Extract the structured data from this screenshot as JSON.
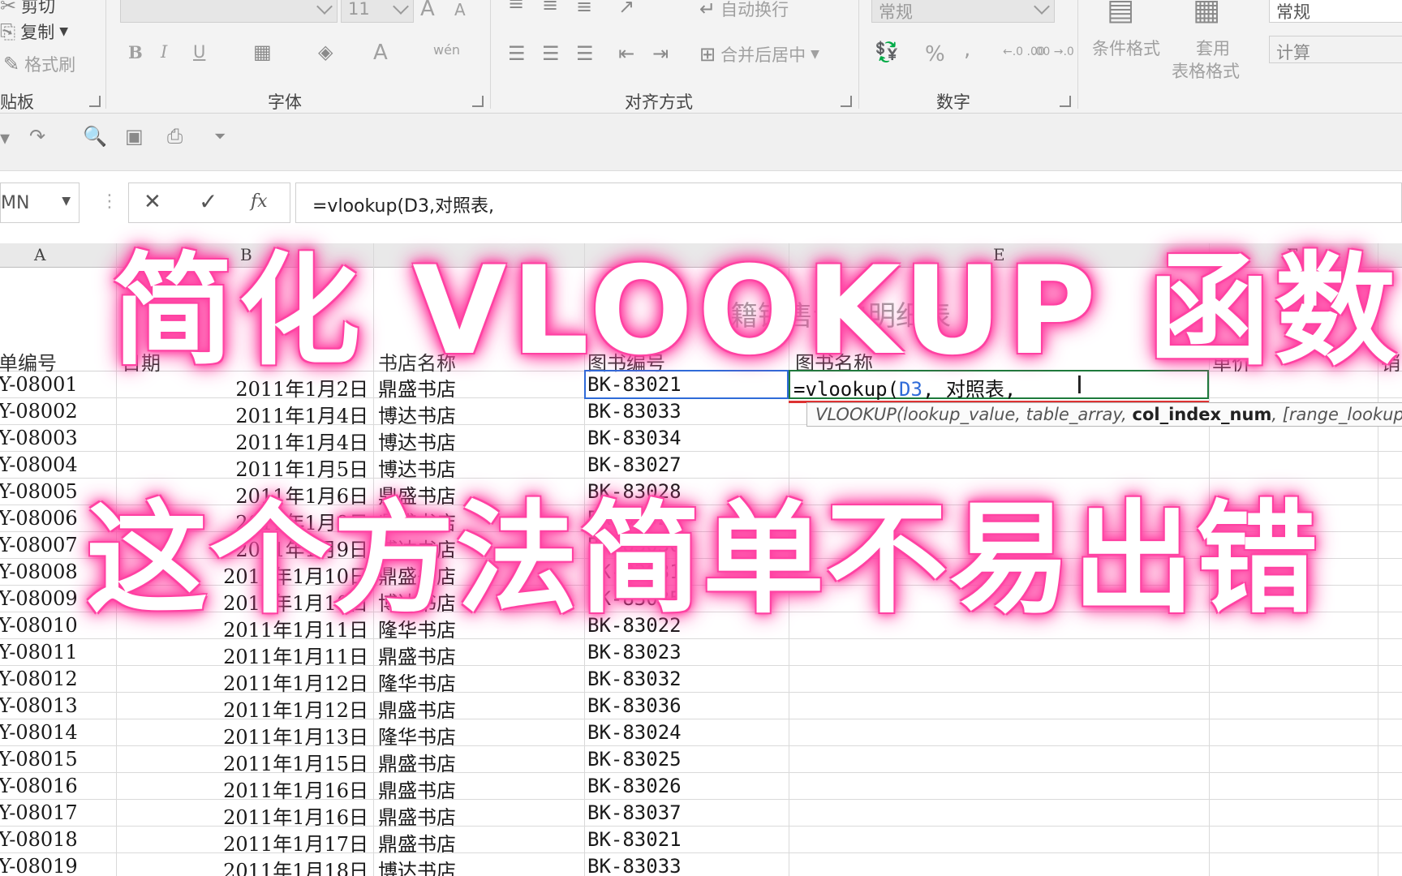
{
  "ribbon": {
    "clipboard": {
      "cut": "剪切",
      "copy": "复制",
      "format_painter": "格式刷",
      "label": "贴板"
    },
    "font": {
      "size": "11",
      "bold": "B",
      "italic": "I",
      "underline": "U",
      "font_color": "A",
      "wen": "wén",
      "label": "字体"
    },
    "alignment": {
      "wrap": "自动换行",
      "merge": "合并后居中",
      "label": "对齐方式"
    },
    "number": {
      "format": "常规",
      "percent": "%",
      "comma": ",",
      "inc_decimal": "←.0 .00",
      "dec_decimal": ".00 →.0",
      "label": "数字"
    },
    "styles": {
      "conditional": "条件格式",
      "table_fmt_1": "套用",
      "table_fmt_2": "表格格式",
      "style_normal": "常规",
      "style_calc": "计算"
    }
  },
  "formula_bar": {
    "name_box": "MN",
    "cancel": "✕",
    "enter": "✓",
    "fx": "fx",
    "content": "=vlookup(D3,对照表,"
  },
  "columns": [
    "A",
    "B",
    "E",
    "F"
  ],
  "sheet": {
    "title_faint": "籍销售订单明细表",
    "headers": {
      "order_no": "单编号",
      "date": "日期",
      "store": "书店名称",
      "book_code": "图书编号",
      "book_name": "图书名称",
      "price": "单价",
      "sales": "销"
    },
    "rows": [
      {
        "no": "Y-08001",
        "date": "2011年1月2日",
        "store": "鼎盛书店",
        "code": "BK-83021"
      },
      {
        "no": "Y-08002",
        "date": "2011年1月4日",
        "store": "博达书店",
        "code": "BK-83033"
      },
      {
        "no": "Y-08003",
        "date": "2011年1月4日",
        "store": "博达书店",
        "code": "BK-83034"
      },
      {
        "no": "Y-08004",
        "date": "2011年1月5日",
        "store": "博达书店",
        "code": "BK-83027"
      },
      {
        "no": "Y-08005",
        "date": "2011年1月6日",
        "store": "鼎盛书店",
        "code": "BK-83028"
      },
      {
        "no": "Y-08006",
        "date": "2011年1月9日",
        "store": "鼎盛书店",
        "code": "BK-83029"
      },
      {
        "no": "Y-08007",
        "date": "2011年1月9日",
        "store": "博达书店",
        "code": "BK-83030"
      },
      {
        "no": "Y-08008",
        "date": "2011年1月10日",
        "store": "鼎盛书店",
        "code": "BK-83031"
      },
      {
        "no": "Y-08009",
        "date": "2011年1月10日",
        "store": "博达书店",
        "code": "BK-83035"
      },
      {
        "no": "Y-08010",
        "date": "2011年1月11日",
        "store": "隆华书店",
        "code": "BK-83022"
      },
      {
        "no": "Y-08011",
        "date": "2011年1月11日",
        "store": "鼎盛书店",
        "code": "BK-83023"
      },
      {
        "no": "Y-08012",
        "date": "2011年1月12日",
        "store": "隆华书店",
        "code": "BK-83032"
      },
      {
        "no": "Y-08013",
        "date": "2011年1月12日",
        "store": "鼎盛书店",
        "code": "BK-83036"
      },
      {
        "no": "Y-08014",
        "date": "2011年1月13日",
        "store": "隆华书店",
        "code": "BK-83024"
      },
      {
        "no": "Y-08015",
        "date": "2011年1月15日",
        "store": "鼎盛书店",
        "code": "BK-83025"
      },
      {
        "no": "Y-08016",
        "date": "2011年1月16日",
        "store": "鼎盛书店",
        "code": "BK-83026"
      },
      {
        "no": "Y-08017",
        "date": "2011年1月16日",
        "store": "鼎盛书店",
        "code": "BK-83037"
      },
      {
        "no": "Y-08018",
        "date": "2011年1月17日",
        "store": "鼎盛书店",
        "code": "BK-83021"
      },
      {
        "no": "Y-08019",
        "date": "2011年1月18日",
        "store": "博达书店",
        "code": "BK-83033"
      }
    ]
  },
  "active_cell": {
    "prefix": "=vlookup(",
    "ref": "D3",
    "suffix": ", 对照表,"
  },
  "tooltip": {
    "fn": "VLOOKUP(lookup_value, table_array, ",
    "bold_arg": "col_index_num",
    "rest": ", [range_lookup])"
  },
  "overlay": {
    "line1": "简化 VLOOKUP 函数",
    "line2": "这个方法简单不易出错"
  },
  "colors": {
    "glow": "#ff3ea0",
    "selection": "#2f6bd8",
    "edit_border": "#1e7a3c"
  }
}
